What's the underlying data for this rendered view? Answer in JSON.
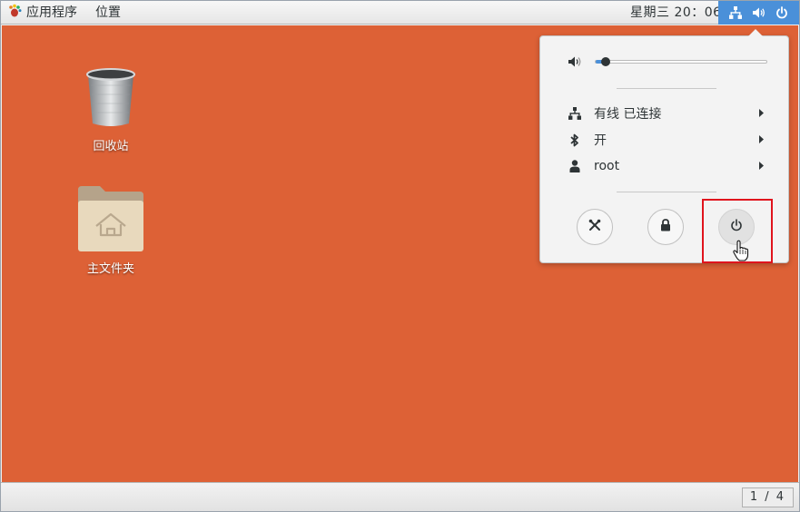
{
  "topbar": {
    "apps_label": "应用程序",
    "places_label": "位置",
    "clock": "星期三 20：06",
    "tray_icons": [
      "network-icon",
      "volume-icon",
      "power-icon"
    ]
  },
  "desktop": {
    "background_color": "#dd6136",
    "icons": [
      {
        "label": "回收站",
        "icon": "trash-icon"
      },
      {
        "label": "主文件夹",
        "icon": "home-folder-icon"
      }
    ]
  },
  "system_menu": {
    "volume": {
      "icon": "volume-muted-icon",
      "level": 0.06
    },
    "items": [
      {
        "label": "有线 已连接",
        "icon": "network-icon"
      },
      {
        "label": "开",
        "icon": "bluetooth-icon"
      },
      {
        "label": "root",
        "icon": "user-icon"
      }
    ],
    "buttons": [
      {
        "name": "settings-button",
        "icon": "settings-icon"
      },
      {
        "name": "lock-button",
        "icon": "lock-icon"
      },
      {
        "name": "power-off-button",
        "icon": "power-icon"
      }
    ],
    "accent_color": "#4a90d9"
  },
  "annotation": {
    "highlight_color": "#e0141d"
  },
  "bottombar": {
    "workspace": "1 / 4"
  }
}
